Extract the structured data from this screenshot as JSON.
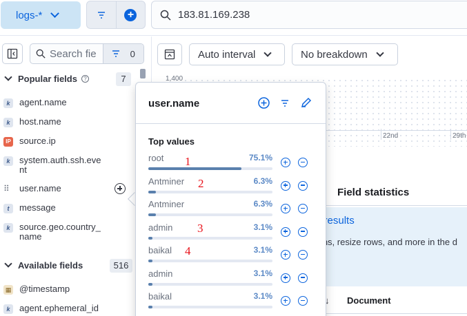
{
  "topbar": {
    "data_view_label": "logs-*",
    "query_value": "183.81.169.238"
  },
  "sidebar": {
    "search_placeholder": "Search field names",
    "filter_count": "0",
    "popular_section": {
      "title": "Popular fields",
      "count": "7"
    },
    "popular_fields": [
      {
        "type": "k",
        "name": "agent.name"
      },
      {
        "type": "k",
        "name": "host.name"
      },
      {
        "type": "IP",
        "name": "source.ip"
      },
      {
        "type": "k",
        "name": "system.auth.ssh.event"
      },
      {
        "type": "drag",
        "name": "user.name"
      },
      {
        "type": "t",
        "name": "message"
      },
      {
        "type": "k",
        "name": "source.geo.country_name"
      }
    ],
    "available_section": {
      "title": "Available fields",
      "count": "516"
    },
    "available_fields": [
      {
        "type": "date",
        "name": "@timestamp"
      },
      {
        "type": "k",
        "name": "agent.ephemeral_id"
      }
    ]
  },
  "main": {
    "interval_label": "Auto interval",
    "breakdown_label": "No breakdown",
    "chart_y_label": "1,400",
    "chart_x_ticks": [
      "22nd",
      "29th"
    ],
    "tab_field_statistics": "Field statistics",
    "callout_title": "n results",
    "callout_text": "mns, resize rows, and more in the d",
    "table_col_document": "Document"
  },
  "popover": {
    "title": "user.name",
    "top_values_title": "Top values",
    "top_values": [
      {
        "label": "root",
        "pct_text": "75.1%",
        "fraction": 0.751
      },
      {
        "label": "Antminer",
        "pct_text": "6.3%",
        "fraction": 0.063
      },
      {
        "label": "Antminer",
        "pct_text": "6.3%",
        "fraction": 0.063
      },
      {
        "label": "admin",
        "pct_text": "3.1%",
        "fraction": 0.031
      },
      {
        "label": "baikal",
        "pct_text": "3.1%",
        "fraction": 0.031
      },
      {
        "label": "admin",
        "pct_text": "3.1%",
        "fraction": 0.031
      },
      {
        "label": "baikal",
        "pct_text": "3.1%",
        "fraction": 0.031
      }
    ],
    "annotations": [
      "1",
      "2",
      "3",
      "4"
    ]
  },
  "colors": {
    "accent": "#0b64dd",
    "bar_fill": "#5a80ad",
    "annotation": "#e8131b"
  }
}
